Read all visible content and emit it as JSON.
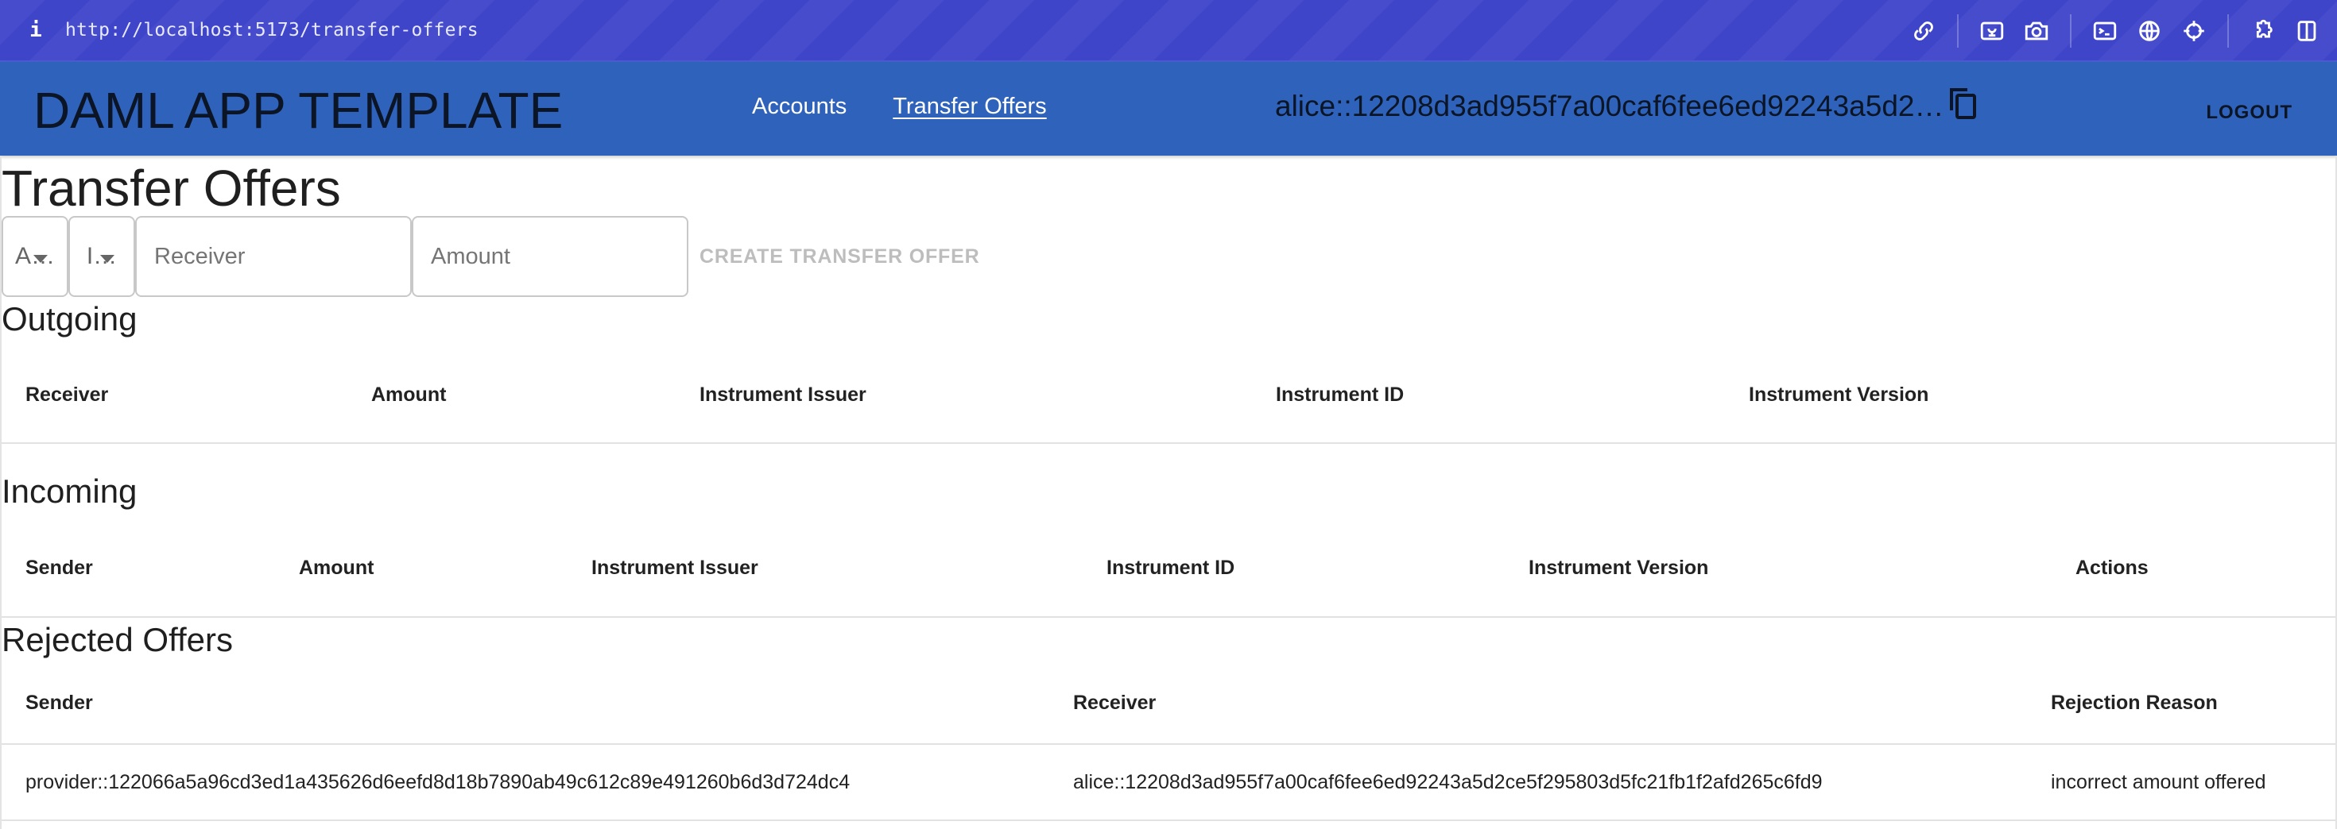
{
  "browser": {
    "url": "http://localhost:5173/transfer-offers",
    "info_icon": "i",
    "tools": [
      "link-icon",
      "image-icon",
      "camera-icon",
      "terminal-icon",
      "globe-icon",
      "crosshair-icon",
      "puzzle-icon",
      "split-view-icon"
    ]
  },
  "header": {
    "brand": "DAML APP TEMPLATE",
    "nav": [
      {
        "label": "Accounts",
        "active": false
      },
      {
        "label": "Transfer Offers",
        "active": true
      }
    ],
    "party_id": "alice::12208d3ad955f7a00caf6fee6ed92243a5d2…",
    "copy_icon": "copy-icon",
    "logout_label": "LOGOUT"
  },
  "page": {
    "title": "Transfer Offers",
    "form": {
      "account_select": {
        "value": "A…"
      },
      "instrument_select": {
        "value": "I…"
      },
      "receiver": {
        "placeholder": "Receiver",
        "value": ""
      },
      "amount": {
        "placeholder": "Amount",
        "value": ""
      },
      "create_label": "CREATE TRANSFER OFFER",
      "create_disabled": true
    },
    "outgoing": {
      "title": "Outgoing",
      "columns": [
        "Receiver",
        "Amount",
        "Instrument Issuer",
        "Instrument ID",
        "Instrument Version"
      ],
      "rows": []
    },
    "incoming": {
      "title": "Incoming",
      "columns": [
        "Sender",
        "Amount",
        "Instrument Issuer",
        "Instrument ID",
        "Instrument Version",
        "Actions"
      ],
      "rows": []
    },
    "rejected": {
      "title": "Rejected Offers",
      "columns": [
        "Sender",
        "Receiver",
        "Rejection Reason"
      ],
      "rows": [
        {
          "sender": "provider::122066a5a96cd3ed1a435626d6eefd8d18b7890ab49c612c89e491260b6d3d724dc4",
          "receiver": "alice::12208d3ad955f7a00caf6fee6ed92243a5d2ce5f295803d5fc21fb1f2afd265c6fd9",
          "reason": "incorrect amount offered"
        }
      ]
    }
  },
  "colors": {
    "browser_bar": "#3f45c9",
    "app_header": "#2f63bb",
    "header_text": "#0b1526",
    "disabled_button": "#bdbdbd"
  }
}
